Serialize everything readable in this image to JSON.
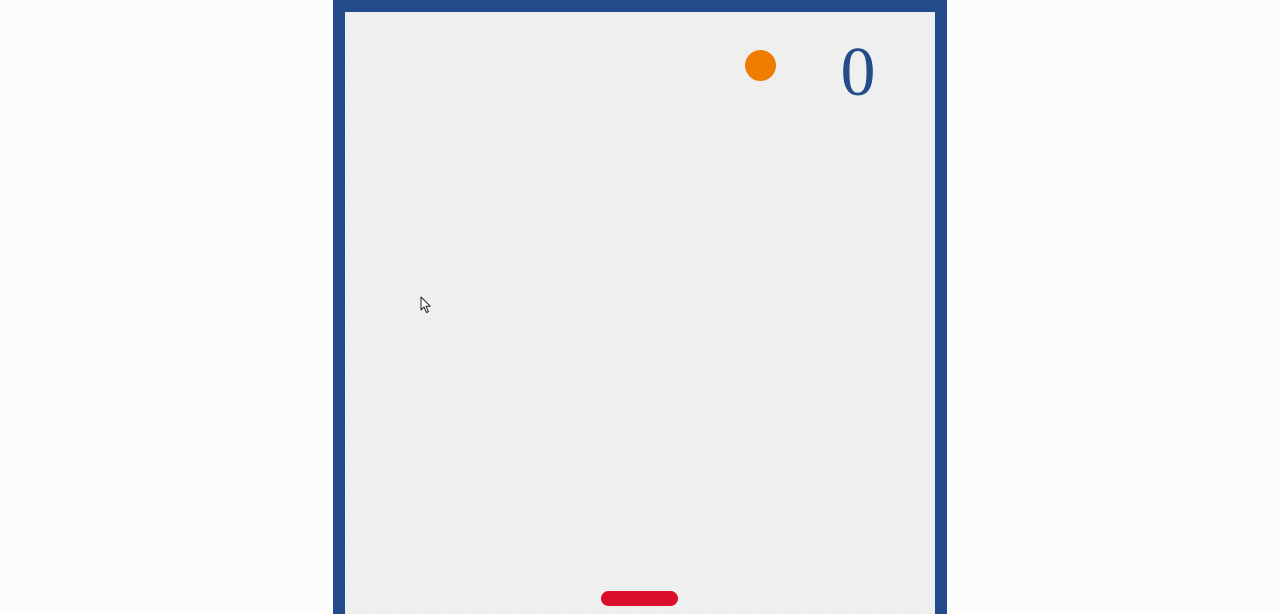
{
  "game": {
    "score": "0"
  },
  "colors": {
    "page_background": "#fcfcfc",
    "board_border": "#244c8a",
    "board_background": "#f1f1f1",
    "ball": "#ef7d00",
    "score_text": "#244c8a",
    "paddle": "#dc0d2b"
  },
  "icons": {
    "cursor": "mouse-pointer-icon"
  }
}
